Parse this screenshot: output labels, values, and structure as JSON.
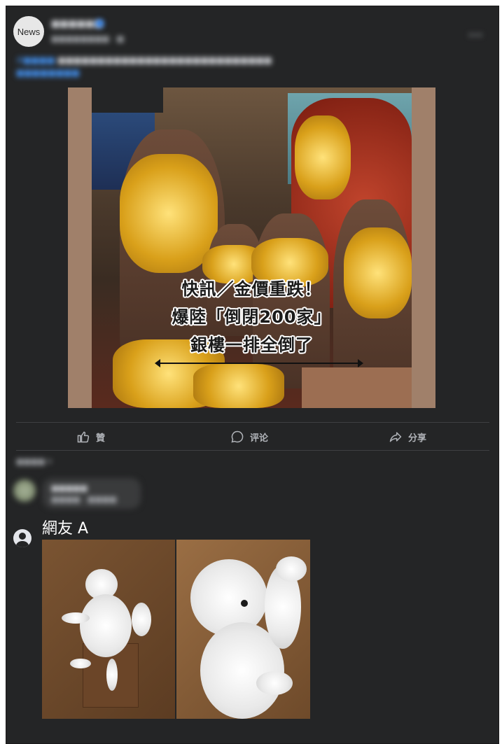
{
  "post": {
    "avatar_text": "News",
    "page_name": "■■■■■■",
    "meta": "■■■■■■■■ · ■",
    "text_tag": "#■■■■",
    "text_body": "■■■■■■■■■■■■■■■■■■■■■■■■■■■",
    "text_link": "■■■■■■■■",
    "image": {
      "headline_lines": [
        "快訊／金價重跌！",
        "爆陸「倒閉200家」",
        "銀樓一排全倒了"
      ]
    }
  },
  "actions": {
    "like": "贊",
    "comment": "评论",
    "share": "分享"
  },
  "comments": {
    "sort_label": "■■■■ ▾",
    "first": {
      "name": "■■■■■",
      "text": "■■■■ · ■■■■"
    },
    "user_a": {
      "name": "網友 A"
    }
  },
  "colors": {
    "background": "#242526",
    "text": "#e4e6eb",
    "muted": "#b0b3b8",
    "link": "#4599ff"
  },
  "icons": [
    "like-icon",
    "comment-icon",
    "share-icon",
    "user-icon",
    "more-icon",
    "verified-icon"
  ]
}
